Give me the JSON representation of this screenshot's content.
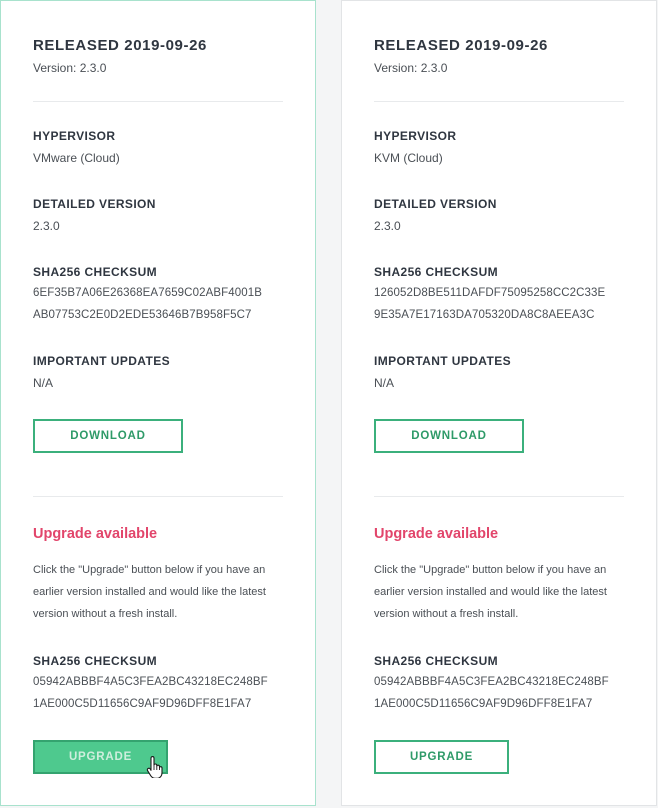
{
  "cards": [
    {
      "released": "RELEASED 2019-09-26",
      "version": "Version: 2.3.0",
      "hypervisor_label": "HYPERVISOR",
      "hypervisor": "VMware (Cloud)",
      "detailed_version_label": "DETAILED VERSION",
      "detailed_version": "2.3.0",
      "checksum_label": "SHA256 CHECKSUM",
      "checksum_line1": "6EF35B7A06E26368EA7659C02ABF4001B",
      "checksum_line2": "AB07753C2E0D2EDE53646B7B958F5C7",
      "important_label": "IMPORTANT UPDATES",
      "important": "N/A",
      "download_label": "DOWNLOAD",
      "upgrade_title": "Upgrade available",
      "upgrade_desc": "Click the \"Upgrade\" button below if you have an earlier version installed and would like the latest version without a fresh install.",
      "upgrade_checksum_label": "SHA256 CHECKSUM",
      "upgrade_checksum_line1": "05942ABBBF4A5C3FEA2BC43218EC248BF",
      "upgrade_checksum_line2": "1AE000C5D11656C9AF9D96DFF8E1FA7",
      "upgrade_label": "UPGRADE",
      "upgrade_state": "hover"
    },
    {
      "released": "RELEASED 2019-09-26",
      "version": "Version: 2.3.0",
      "hypervisor_label": "HYPERVISOR",
      "hypervisor": "KVM (Cloud)",
      "detailed_version_label": "DETAILED VERSION",
      "detailed_version": "2.3.0",
      "checksum_label": "SHA256 CHECKSUM",
      "checksum_line1": "126052D8BE511DAFDF75095258CC2C33E",
      "checksum_line2": "9E35A7E17163DA705320DA8C8AEEA3C",
      "important_label": "IMPORTANT UPDATES",
      "important": "N/A",
      "download_label": "DOWNLOAD",
      "upgrade_title": "Upgrade available",
      "upgrade_desc": "Click the \"Upgrade\" button below if you have an earlier version installed and would like the latest version without a fresh install.",
      "upgrade_checksum_label": "SHA256 CHECKSUM",
      "upgrade_checksum_line1": "05942ABBBF4A5C3FEA2BC43218EC248BF",
      "upgrade_checksum_line2": "1AE000C5D11656C9AF9D96DFF8E1FA7",
      "upgrade_label": "UPGRADE",
      "upgrade_state": "normal"
    }
  ],
  "colors": {
    "accent_green": "#3bb07c",
    "upgrade_red": "#e2456b",
    "selected_border": "#a8e2cd"
  },
  "icons": {
    "cursor": "hand-pointer-icon"
  }
}
